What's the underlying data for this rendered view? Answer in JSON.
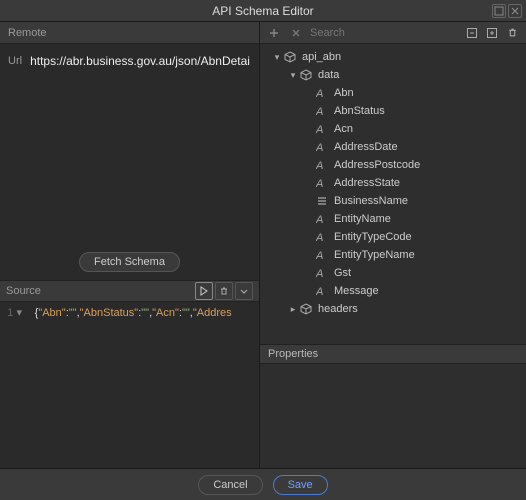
{
  "title": "API Schema Editor",
  "left": {
    "remote_header": "Remote",
    "url_label": "Url",
    "url_value": "https://abr.business.gov.au/json/AbnDetai",
    "fetch_label": "Fetch Schema",
    "source_header": "Source",
    "source_line_number": "1",
    "source_code_segments": [
      {
        "t": "brace",
        "v": "{"
      },
      {
        "t": "key",
        "v": "\"Abn\""
      },
      {
        "t": "colon",
        "v": ":"
      },
      {
        "t": "val",
        "v": "\"\""
      },
      {
        "t": "comma",
        "v": ","
      },
      {
        "t": "key",
        "v": "\"AbnStatus\""
      },
      {
        "t": "colon",
        "v": ":"
      },
      {
        "t": "val",
        "v": "\"\""
      },
      {
        "t": "comma",
        "v": ","
      },
      {
        "t": "key",
        "v": "\"Acn\""
      },
      {
        "t": "colon",
        "v": ":"
      },
      {
        "t": "val",
        "v": "\"\""
      },
      {
        "t": "comma",
        "v": ","
      },
      {
        "t": "key",
        "v": "\"Addres"
      }
    ]
  },
  "right": {
    "search_placeholder": "Search",
    "tree": [
      {
        "level": 1,
        "caret": "down",
        "icon": "box",
        "label": "api_abn"
      },
      {
        "level": 2,
        "caret": "down",
        "icon": "box",
        "label": "data"
      },
      {
        "level": 3,
        "caret": "",
        "icon": "A",
        "label": "Abn"
      },
      {
        "level": 3,
        "caret": "",
        "icon": "A",
        "label": "AbnStatus"
      },
      {
        "level": 3,
        "caret": "",
        "icon": "A",
        "label": "Acn"
      },
      {
        "level": 3,
        "caret": "",
        "icon": "A",
        "label": "AddressDate"
      },
      {
        "level": 3,
        "caret": "",
        "icon": "A",
        "label": "AddressPostcode"
      },
      {
        "level": 3,
        "caret": "",
        "icon": "A",
        "label": "AddressState"
      },
      {
        "level": 3,
        "caret": "",
        "icon": "list",
        "label": "BusinessName"
      },
      {
        "level": 3,
        "caret": "",
        "icon": "A",
        "label": "EntityName"
      },
      {
        "level": 3,
        "caret": "",
        "icon": "A",
        "label": "EntityTypeCode"
      },
      {
        "level": 3,
        "caret": "",
        "icon": "A",
        "label": "EntityTypeName"
      },
      {
        "level": 3,
        "caret": "",
        "icon": "A",
        "label": "Gst"
      },
      {
        "level": 3,
        "caret": "",
        "icon": "A",
        "label": "Message"
      },
      {
        "level": 2,
        "caret": "right",
        "icon": "box",
        "label": "headers"
      }
    ],
    "properties_header": "Properties"
  },
  "footer": {
    "cancel": "Cancel",
    "save": "Save"
  }
}
